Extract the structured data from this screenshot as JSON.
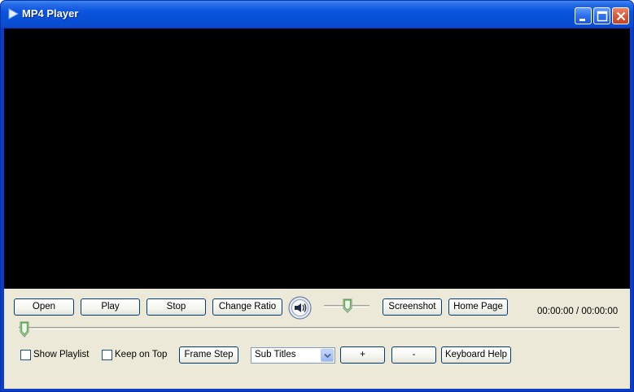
{
  "window": {
    "title": "MP4 Player"
  },
  "controls": {
    "open": "Open",
    "play": "Play",
    "stop": "Stop",
    "change_ratio": "Change Ratio",
    "screenshot": "Screenshot",
    "home_page": "Home Page",
    "time": "00:00:00 / 00:00:00",
    "volume_level": 0.55,
    "seek_position": 0.0
  },
  "options": {
    "show_playlist": {
      "label": "Show Playlist",
      "checked": false
    },
    "keep_on_top": {
      "label": "Keep on Top",
      "checked": false
    },
    "frame_step": "Frame Step",
    "subtitles": {
      "selected": "Sub Titles"
    },
    "plus": "+",
    "minus": "-",
    "keyboard_help": "Keyboard Help"
  },
  "colors": {
    "titlebar": "#0a55e0",
    "video_bg": "#000000",
    "panel_bg": "#ece9d8",
    "close_button": "#d95a3a"
  }
}
